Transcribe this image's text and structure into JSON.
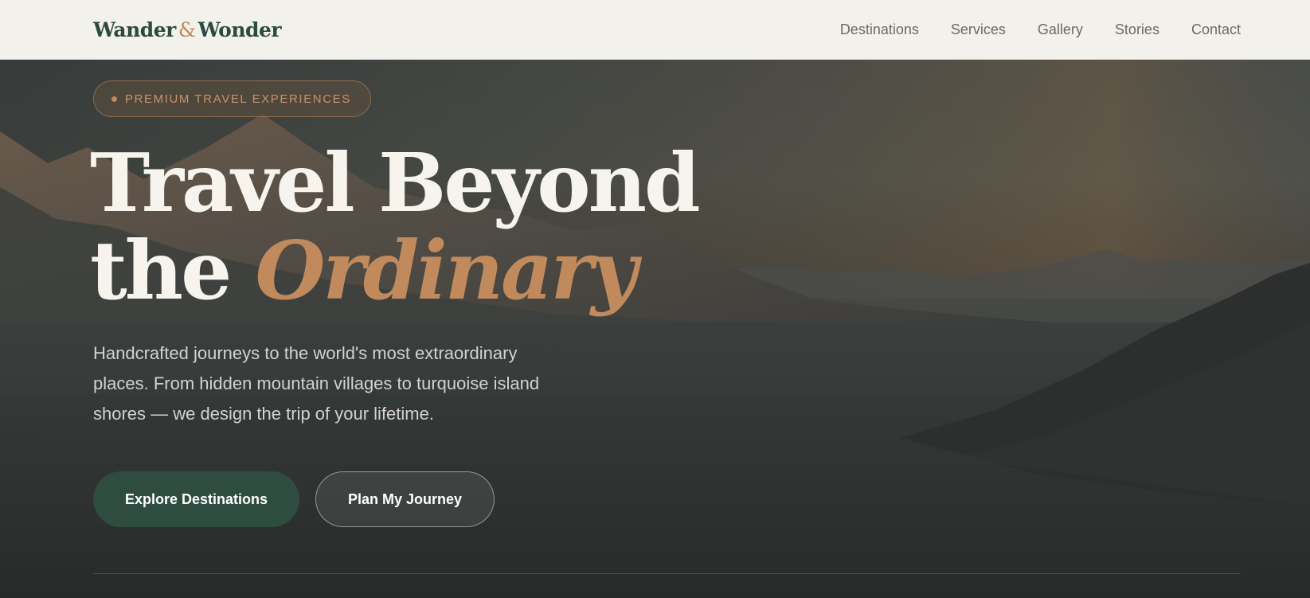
{
  "header": {
    "logo_left": "Wander",
    "logo_amp": "&",
    "logo_right": "Wonder",
    "nav": [
      "Destinations",
      "Services",
      "Gallery",
      "Stories",
      "Contact"
    ]
  },
  "hero": {
    "badge": "PREMIUM TRAVEL EXPERIENCES",
    "title_line1": "Travel Beyond",
    "title_line2_plain": "the",
    "title_line2_accent": "Ordinary",
    "lead": "Handcrafted journeys to the world's most extraordinary places. From hidden mountain villages to turquoise island shores — we design the trip of your lifetime.",
    "primary_button": "Explore Destinations",
    "secondary_button": "Plan My Journey"
  },
  "colors": {
    "brand_green": "#2e4c3f",
    "accent_copper": "#c08a5c",
    "header_bg": "#f3f1ec"
  }
}
